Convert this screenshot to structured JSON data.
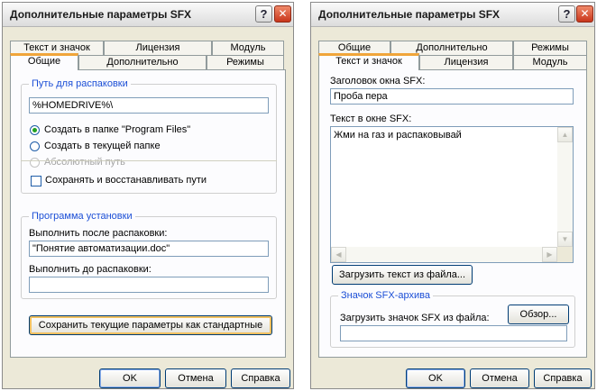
{
  "left_dialog": {
    "title": "Дополнительные параметры SFX",
    "help_label": "?",
    "close_label": "✕",
    "tabs_back": [
      "Текст и значок",
      "Лицензия",
      "Модуль"
    ],
    "tabs_front": [
      "Общие",
      "Дополнительно",
      "Режимы"
    ],
    "active_tab": "Общие",
    "path_group": {
      "legend": "Путь для распаковки",
      "path_value": "%HOMEDRIVE%\\",
      "radio_program_files": "Создать в папке \"Program Files\"",
      "radio_current_folder": "Создать в текущей папке",
      "radio_absolute": "Абсолютный путь",
      "save_restore_paths": "Сохранять и восстанавливать пути"
    },
    "install_group": {
      "legend": "Программа установки",
      "after_label": "Выполнить после распаковки:",
      "after_value": "\"Понятие автоматизации.doc\"",
      "before_label": "Выполнить до распаковки:",
      "before_value": ""
    },
    "save_defaults_button": "Сохранить текущие параметры как стандартные",
    "buttons": {
      "ok": "OK",
      "cancel": "Отмена",
      "help": "Справка"
    }
  },
  "right_dialog": {
    "title": "Дополнительные параметры SFX",
    "help_label": "?",
    "close_label": "✕",
    "tabs_back": [
      "Общие",
      "Дополнительно",
      "Режимы"
    ],
    "tabs_front": [
      "Текст и значок",
      "Лицензия",
      "Модуль"
    ],
    "active_tab": "Текст и значок",
    "window_title_label": "Заголовок окна SFX:",
    "window_title_value": "Проба пера",
    "window_text_label": "Текст в окне SFX:",
    "window_text_value": "Жми на газ и распаковывай",
    "load_text_button": "Загрузить текст из файла...",
    "icon_group": {
      "legend": "Значок SFX-архива",
      "load_icon_label": "Загрузить значок SFX из файла:",
      "browse_button": "Обзор...",
      "icon_path_value": ""
    },
    "buttons": {
      "ok": "OK",
      "cancel": "Отмена",
      "help": "Справка"
    }
  },
  "icons": {
    "scroll_up": "▲",
    "scroll_down": "▼",
    "scroll_left": "◀",
    "scroll_right": "▶"
  },
  "colors": {
    "accent_tab": "#f0a53a",
    "legend": "#1c4fd6",
    "close_button": "#c8361b",
    "radio_dot": "#21a121"
  }
}
